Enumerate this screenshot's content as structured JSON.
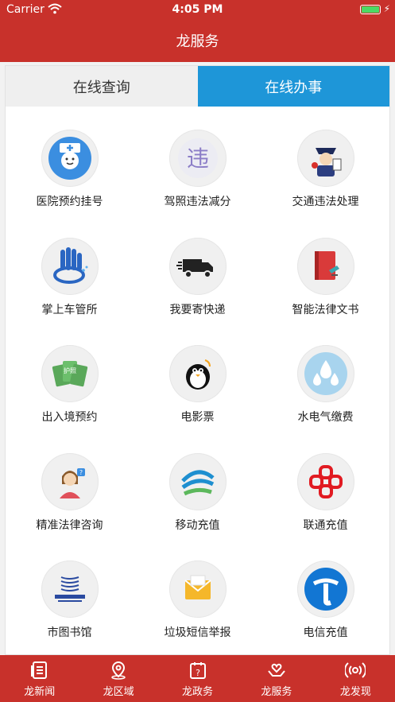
{
  "status": {
    "carrier": "Carrier",
    "time": "4:05 PM"
  },
  "nav": {
    "title": "龙服务"
  },
  "tabs": [
    {
      "label": "在线查询",
      "active": false
    },
    {
      "label": "在线办事",
      "active": true
    }
  ],
  "services": [
    {
      "label": "医院预约挂号",
      "icon": "doctor-icon"
    },
    {
      "label": "驾照违法减分",
      "icon": "violation-badge-icon"
    },
    {
      "label": "交通违法处理",
      "icon": "traffic-police-icon"
    },
    {
      "label": "掌上车管所",
      "icon": "hand-car-icon"
    },
    {
      "label": "我要寄快递",
      "icon": "delivery-truck-icon"
    },
    {
      "label": "智能法律文书",
      "icon": "law-book-icon"
    },
    {
      "label": "出入境预约",
      "icon": "passport-icon"
    },
    {
      "label": "电影票",
      "icon": "penguin-icon"
    },
    {
      "label": "水电气缴费",
      "icon": "water-drops-icon"
    },
    {
      "label": "精准法律咨询",
      "icon": "legal-advisor-icon"
    },
    {
      "label": "移动充值",
      "icon": "china-mobile-icon"
    },
    {
      "label": "联通充值",
      "icon": "china-unicom-icon"
    },
    {
      "label": "市图书馆",
      "icon": "library-icon"
    },
    {
      "label": "垃圾短信举报",
      "icon": "envelope-icon"
    },
    {
      "label": "电信充值",
      "icon": "china-telecom-icon"
    }
  ],
  "tabbar": [
    {
      "label": "龙新闻",
      "icon": "news-icon"
    },
    {
      "label": "龙区域",
      "icon": "location-pin-icon"
    },
    {
      "label": "龙政务",
      "icon": "calendar-question-icon"
    },
    {
      "label": "龙服务",
      "icon": "service-hands-icon"
    },
    {
      "label": "龙发现",
      "icon": "broadcast-icon"
    }
  ]
}
